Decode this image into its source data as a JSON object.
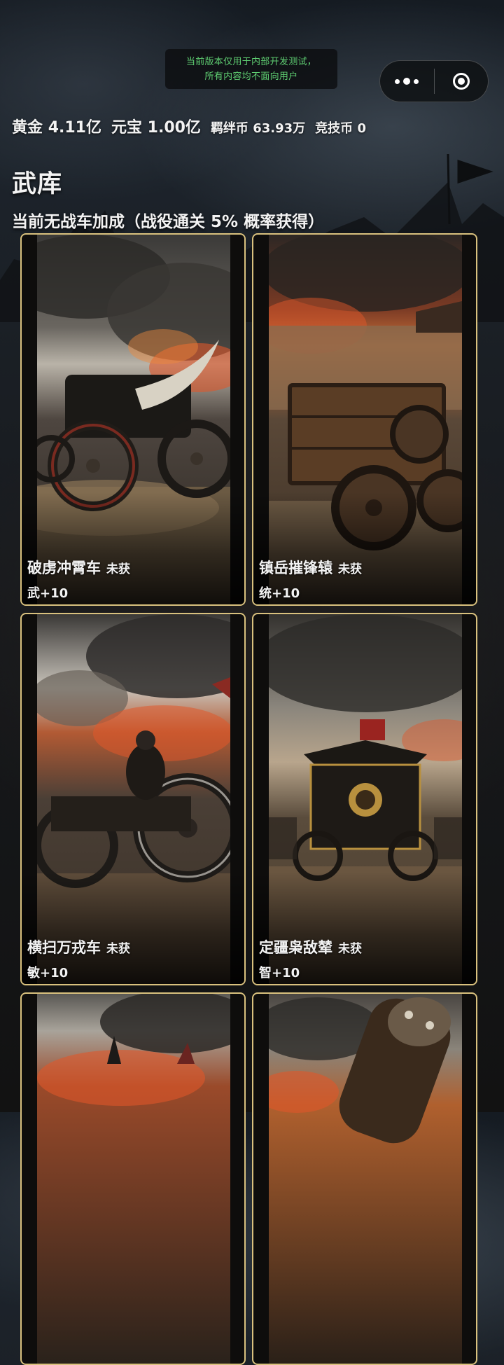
{
  "dev_notice": {
    "line1": "当前版本仅用于内部开发测试，",
    "line2": "所有内容均不面向用户"
  },
  "capsule": {
    "more_icon": "more-dots-icon",
    "close_icon": "target-circle-icon"
  },
  "currencies": [
    {
      "label": "黄金",
      "value": "4.11亿"
    },
    {
      "label": "元宝",
      "value": "1.00亿"
    },
    {
      "label": "羁绊币",
      "value": "63.93万"
    },
    {
      "label": "竞技币",
      "value": "0"
    }
  ],
  "page": {
    "title": "武库",
    "bonus_text": "当前无战车加成（战役通关 5% 概率获得）"
  },
  "chariots": [
    {
      "name": "破虏冲霄车",
      "status": "未获",
      "stat": "武+10"
    },
    {
      "name": "镇岳摧锋辕",
      "status": "未获",
      "stat": "统+10"
    },
    {
      "name": "横扫万戎车",
      "status": "未获",
      "stat": "敏+10"
    },
    {
      "name": "定疆枭敌辇",
      "status": "未获",
      "stat": "智+10"
    },
    {
      "name": "",
      "status": "",
      "stat": ""
    },
    {
      "name": "",
      "status": "",
      "stat": ""
    }
  ],
  "colors": {
    "card_border": "#d9c17e",
    "notice_text": "#5fcf72",
    "fire": "#e0572a"
  }
}
